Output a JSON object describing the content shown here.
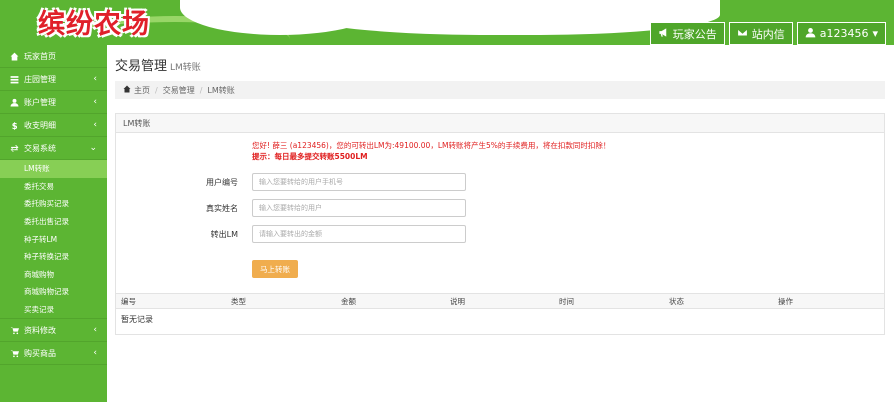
{
  "header": {
    "logo": "缤纷农场",
    "buttons": [
      {
        "label": "玩家公告",
        "icon": "megaphone-icon"
      },
      {
        "label": "站内信",
        "icon": "envelope-icon"
      },
      {
        "label": "a123456",
        "icon": "user-icon",
        "caret": "▾"
      }
    ]
  },
  "sidebar": {
    "items": [
      {
        "label": "玩家首页",
        "icon": "home-icon",
        "arrow": ""
      },
      {
        "label": "庄园管理",
        "icon": "list-icon",
        "arrow": "‹"
      },
      {
        "label": "账户管理",
        "icon": "user-icon",
        "arrow": "‹"
      },
      {
        "label": "收支明细",
        "icon": "dollar-icon",
        "arrow": "‹"
      },
      {
        "label": "交易系统",
        "icon": "exchange-icon",
        "arrow": "⌄"
      }
    ],
    "sub_items": [
      "LM转账",
      "委托交易",
      "委托购买记录",
      "委托出售记录",
      "种子转LM",
      "种子转换记录",
      "商城购物",
      "商城购物记录",
      "买卖记录"
    ],
    "bottom_items": [
      {
        "label": "资料修改",
        "icon": "cart-icon",
        "arrow": "‹"
      },
      {
        "label": "购买商品",
        "icon": "cart-icon",
        "arrow": "‹"
      }
    ]
  },
  "main": {
    "title": "交易管理",
    "subtitle": "LM转账",
    "breadcrumb": [
      "主页",
      "交易管理",
      "LM转账"
    ],
    "panel_title": "LM转账",
    "notice_line1": "您好! 薛三 (a123456)，您的可转出LM为:49100.00，LM转账将产生5%的手续费用，将在扣款同时扣除！",
    "notice_line2": "提示：每日最多提交转账5500LM",
    "form": {
      "user_label": "用户编号",
      "user_placeholder": "输入您要转给的用户手机号",
      "name_label": "真实姓名",
      "name_placeholder": "输入您要转给的用户",
      "amount_label": "转出LM",
      "amount_placeholder": "请输入要转出的金额",
      "submit": "马上转账"
    },
    "table": {
      "columns": [
        "编号",
        "类型",
        "金额",
        "说明",
        "时间",
        "状态",
        "操作"
      ],
      "empty": "暂无记录"
    }
  }
}
